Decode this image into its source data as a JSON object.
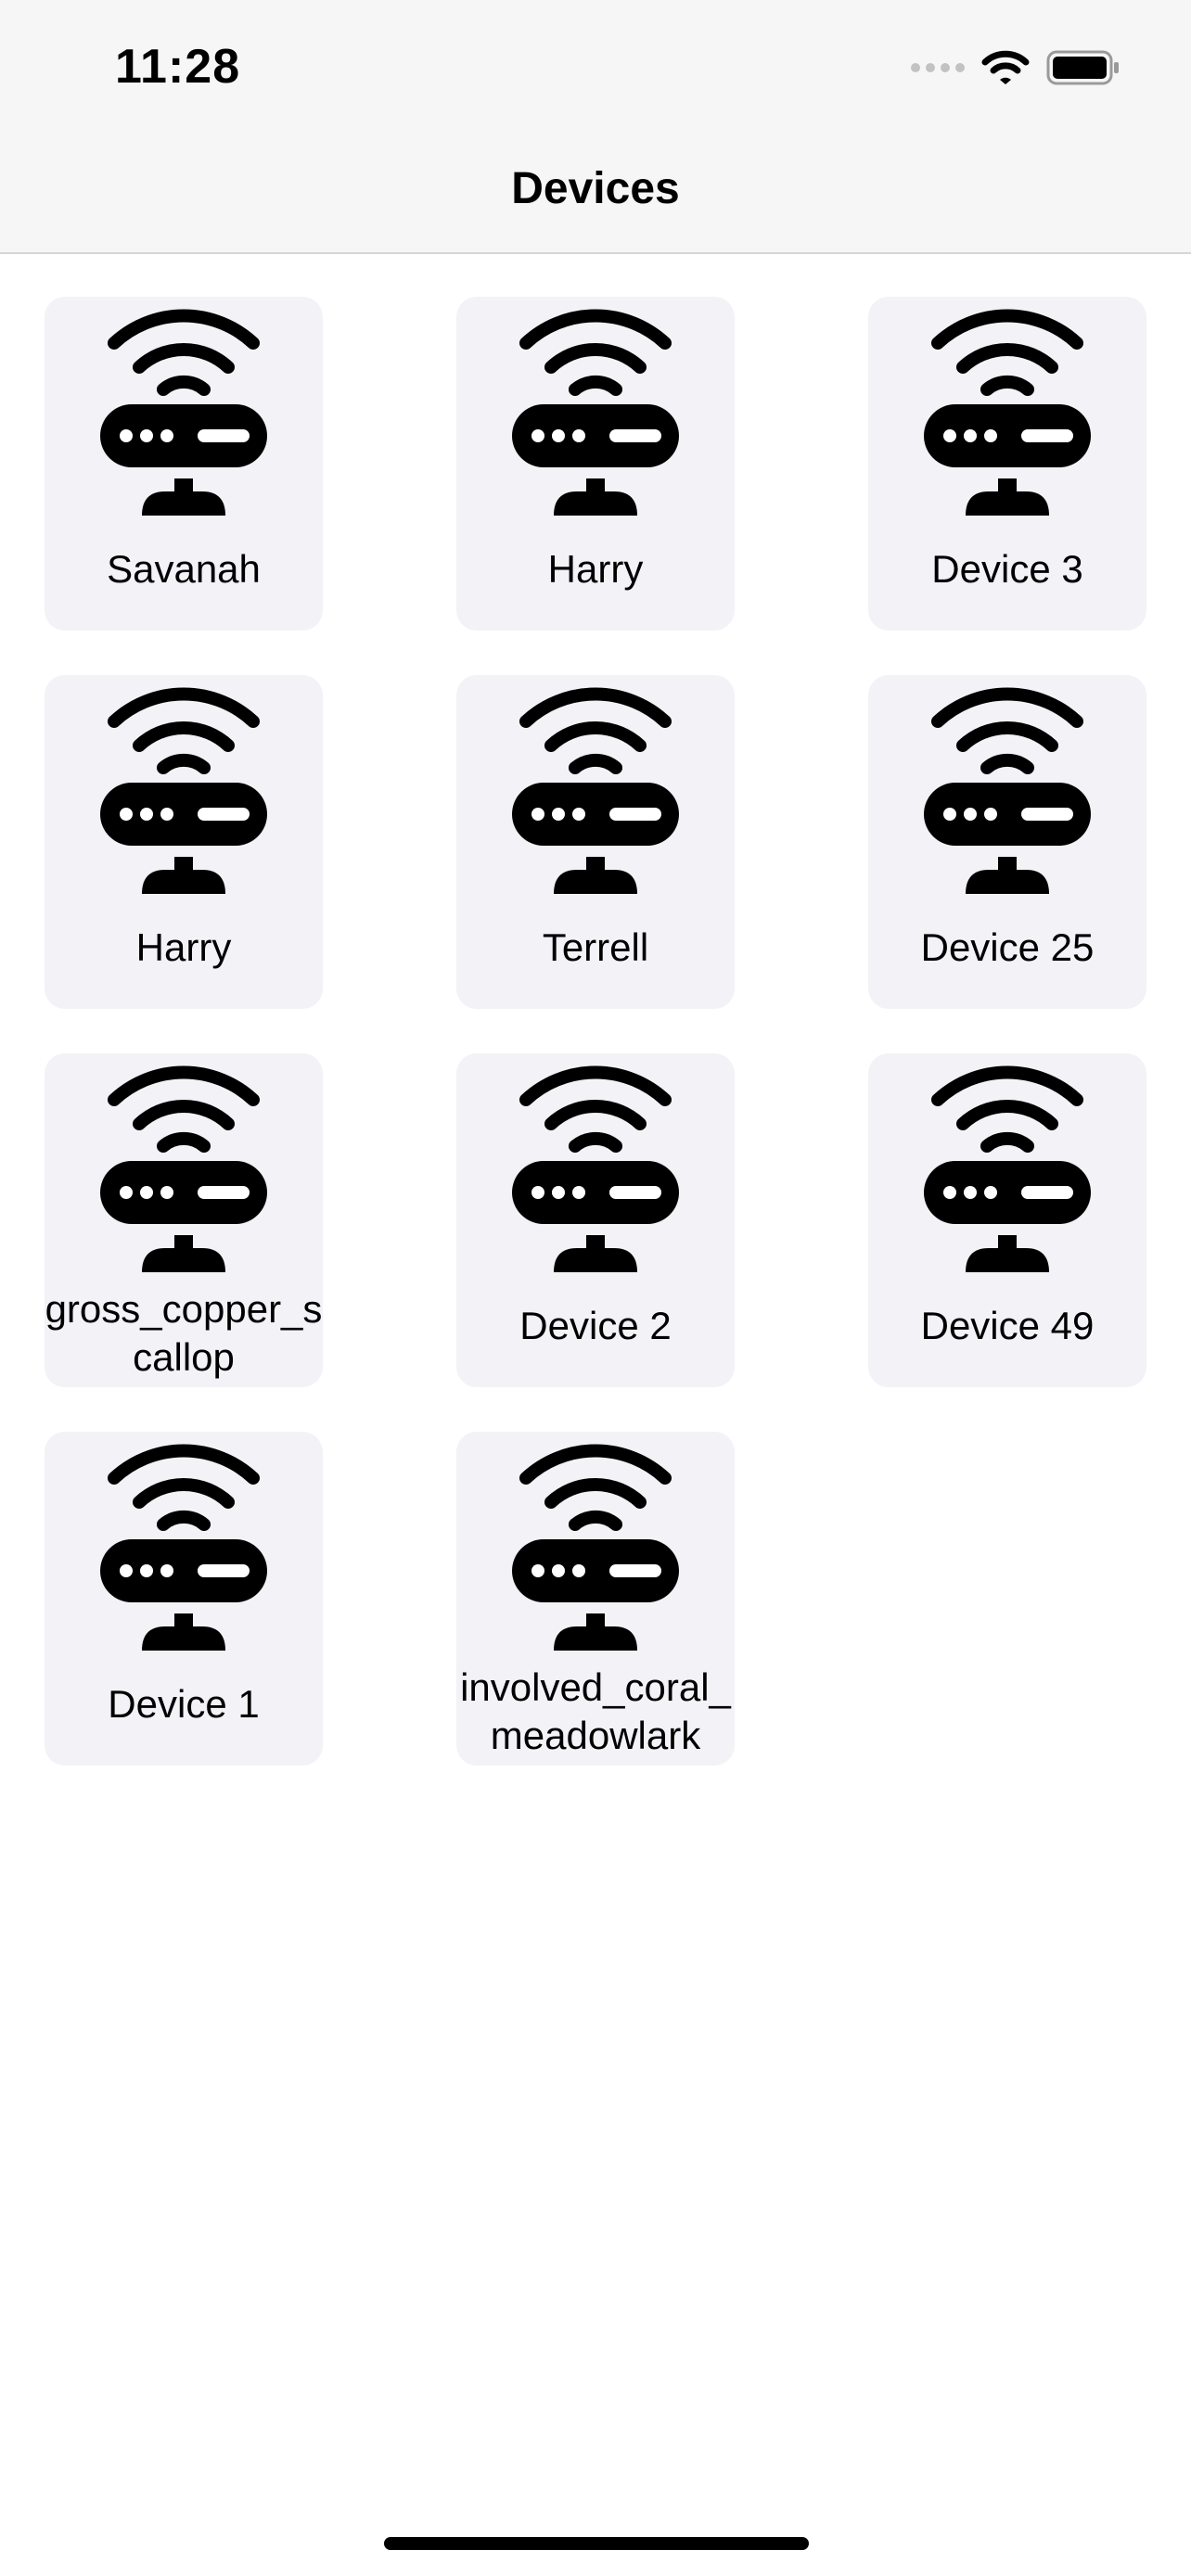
{
  "status_bar": {
    "time": "11:28",
    "icons": [
      "cellular-signal-icon",
      "wifi-icon",
      "battery-icon"
    ]
  },
  "nav": {
    "title": "Devices"
  },
  "devices": [
    {
      "label": "Savanah",
      "icon": "router-wifi-icon"
    },
    {
      "label": "Harry",
      "icon": "router-wifi-icon"
    },
    {
      "label": "Device 3",
      "icon": "router-wifi-icon"
    },
    {
      "label": "Harry",
      "icon": "router-wifi-icon"
    },
    {
      "label": "Terrell",
      "icon": "router-wifi-icon"
    },
    {
      "label": "Device 25",
      "icon": "router-wifi-icon"
    },
    {
      "label": "gross_copper_scallop",
      "icon": "router-wifi-icon"
    },
    {
      "label": "Device 2",
      "icon": "router-wifi-icon"
    },
    {
      "label": "Device 49",
      "icon": "router-wifi-icon"
    },
    {
      "label": "Device 1",
      "icon": "router-wifi-icon"
    },
    {
      "label": "involved_coral_meadowlark",
      "icon": "router-wifi-icon"
    }
  ],
  "colors": {
    "header_bg": "#f6f6f6",
    "tile_bg": "#f2f2f7",
    "icon": "#000000"
  }
}
